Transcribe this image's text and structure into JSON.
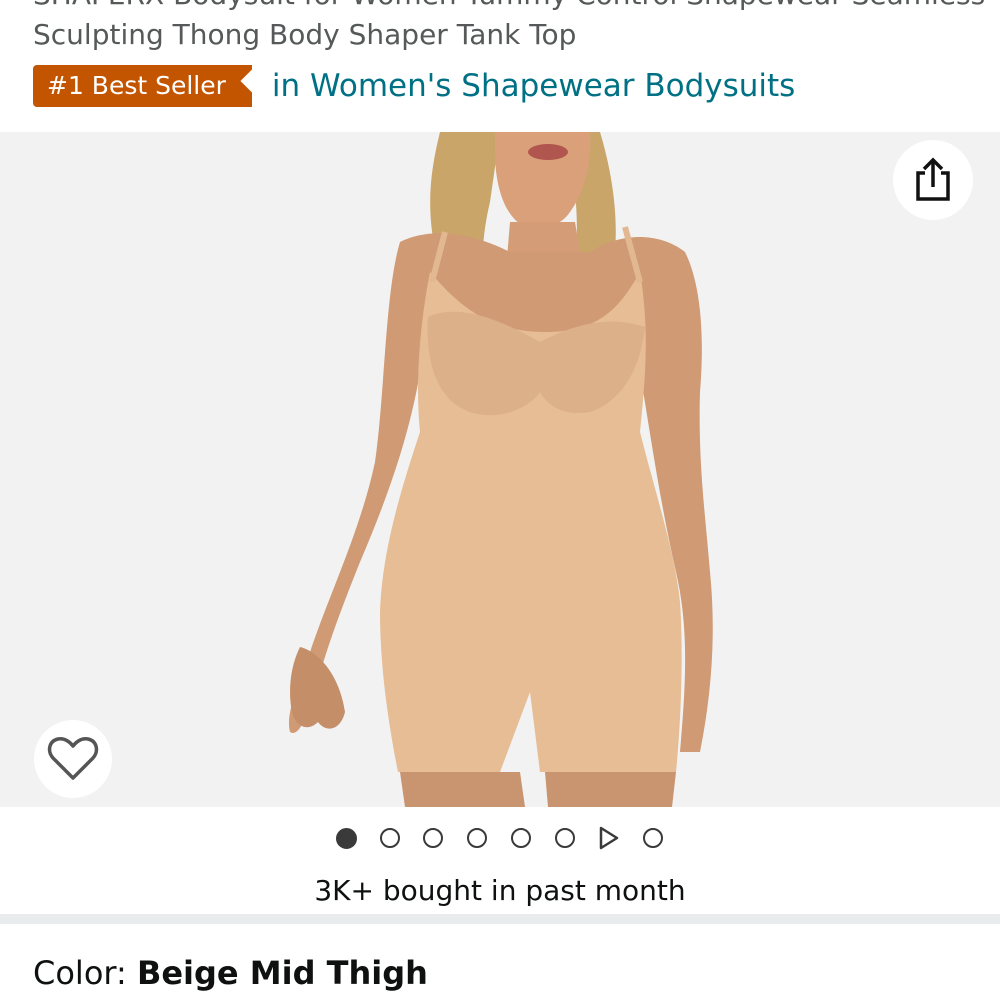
{
  "product": {
    "title_line1": "SHAPERX Bodysuit for Women Tummy Control Shapewear Seamless",
    "title_line2": "Sculpting Thong Body Shaper Tank Top"
  },
  "best_seller": {
    "badge": "#1 Best Seller",
    "category_link": "in Women's Shapewear Bodysuits"
  },
  "icons": {
    "share": "share-icon",
    "wishlist": "heart-icon",
    "video_play": "play-icon"
  },
  "gallery": {
    "dot_count": 8,
    "active_index": 0,
    "video_index": 6
  },
  "social_proof": "3K+ bought in past month",
  "color": {
    "label": "Color: ",
    "value": "Beige Mid Thigh"
  },
  "colors": {
    "badge_bg": "#c45500",
    "link": "#007185",
    "image_bg": "#f2f2f2"
  }
}
